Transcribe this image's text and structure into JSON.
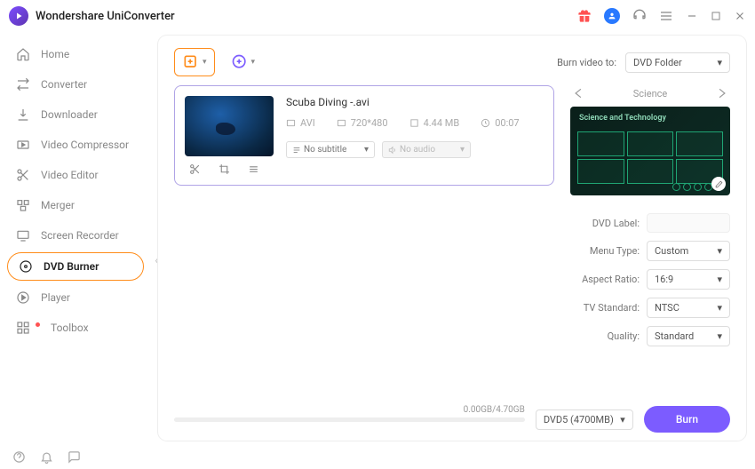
{
  "app": {
    "title": "Wondershare UniConverter"
  },
  "sidebar": {
    "items": [
      {
        "icon": "home",
        "label": "Home"
      },
      {
        "icon": "converter",
        "label": "Converter"
      },
      {
        "icon": "downloader",
        "label": "Downloader"
      },
      {
        "icon": "compressor",
        "label": "Video Compressor"
      },
      {
        "icon": "editor",
        "label": "Video Editor"
      },
      {
        "icon": "merger",
        "label": "Merger"
      },
      {
        "icon": "recorder",
        "label": "Screen Recorder"
      },
      {
        "icon": "dvd",
        "label": "DVD Burner"
      },
      {
        "icon": "player",
        "label": "Player"
      },
      {
        "icon": "toolbox",
        "label": "Toolbox"
      }
    ]
  },
  "toolbar": {
    "burn_to_label": "Burn video to:",
    "burn_to_value": "DVD Folder"
  },
  "file": {
    "name": "Scuba Diving -.avi",
    "format": "AVI",
    "resolution": "720*480",
    "size": "4.44 MB",
    "duration": "00:07",
    "subtitle": "No subtitle",
    "audio": "No audio"
  },
  "template": {
    "name": "Science",
    "preview_title": "Science and Technology"
  },
  "settings": {
    "dvd_label_label": "DVD Label:",
    "dvd_label_value": "",
    "menu_type_label": "Menu Type:",
    "menu_type_value": "Custom",
    "aspect_label": "Aspect Ratio:",
    "aspect_value": "16:9",
    "tv_label": "TV Standard:",
    "tv_value": "NTSC",
    "quality_label": "Quality:",
    "quality_value": "Standard"
  },
  "footer": {
    "progress_text": "0.00GB/4.70GB",
    "disc_value": "DVD5 (4700MB)",
    "burn_label": "Burn"
  }
}
